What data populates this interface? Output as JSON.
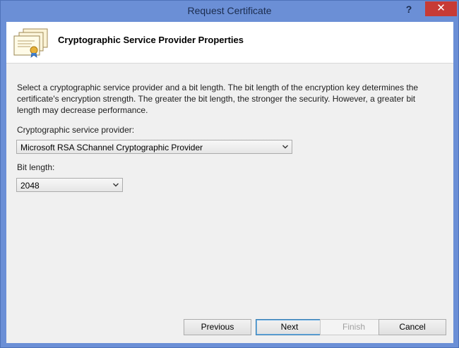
{
  "window": {
    "title": "Request Certificate",
    "help_glyph": "?",
    "close_glyph": "✕"
  },
  "header": {
    "title": "Cryptographic Service Provider Properties",
    "icon": "certificate-icon"
  },
  "description": "Select a cryptographic service provider and a bit length. The bit length of the encryption key determines the certificate's encryption strength. The greater the bit length, the stronger the security. However, a greater bit length may decrease performance.",
  "csp": {
    "label": "Cryptographic service provider:",
    "selected": "Microsoft RSA SChannel Cryptographic Provider"
  },
  "bit_length": {
    "label": "Bit length:",
    "selected": "2048"
  },
  "buttons": {
    "previous": "Previous",
    "next": "Next",
    "finish": "Finish",
    "cancel": "Cancel"
  },
  "colors": {
    "titlebar": "#6b8fd6",
    "close": "#c73b36",
    "client_bg": "#f0f0f0"
  }
}
